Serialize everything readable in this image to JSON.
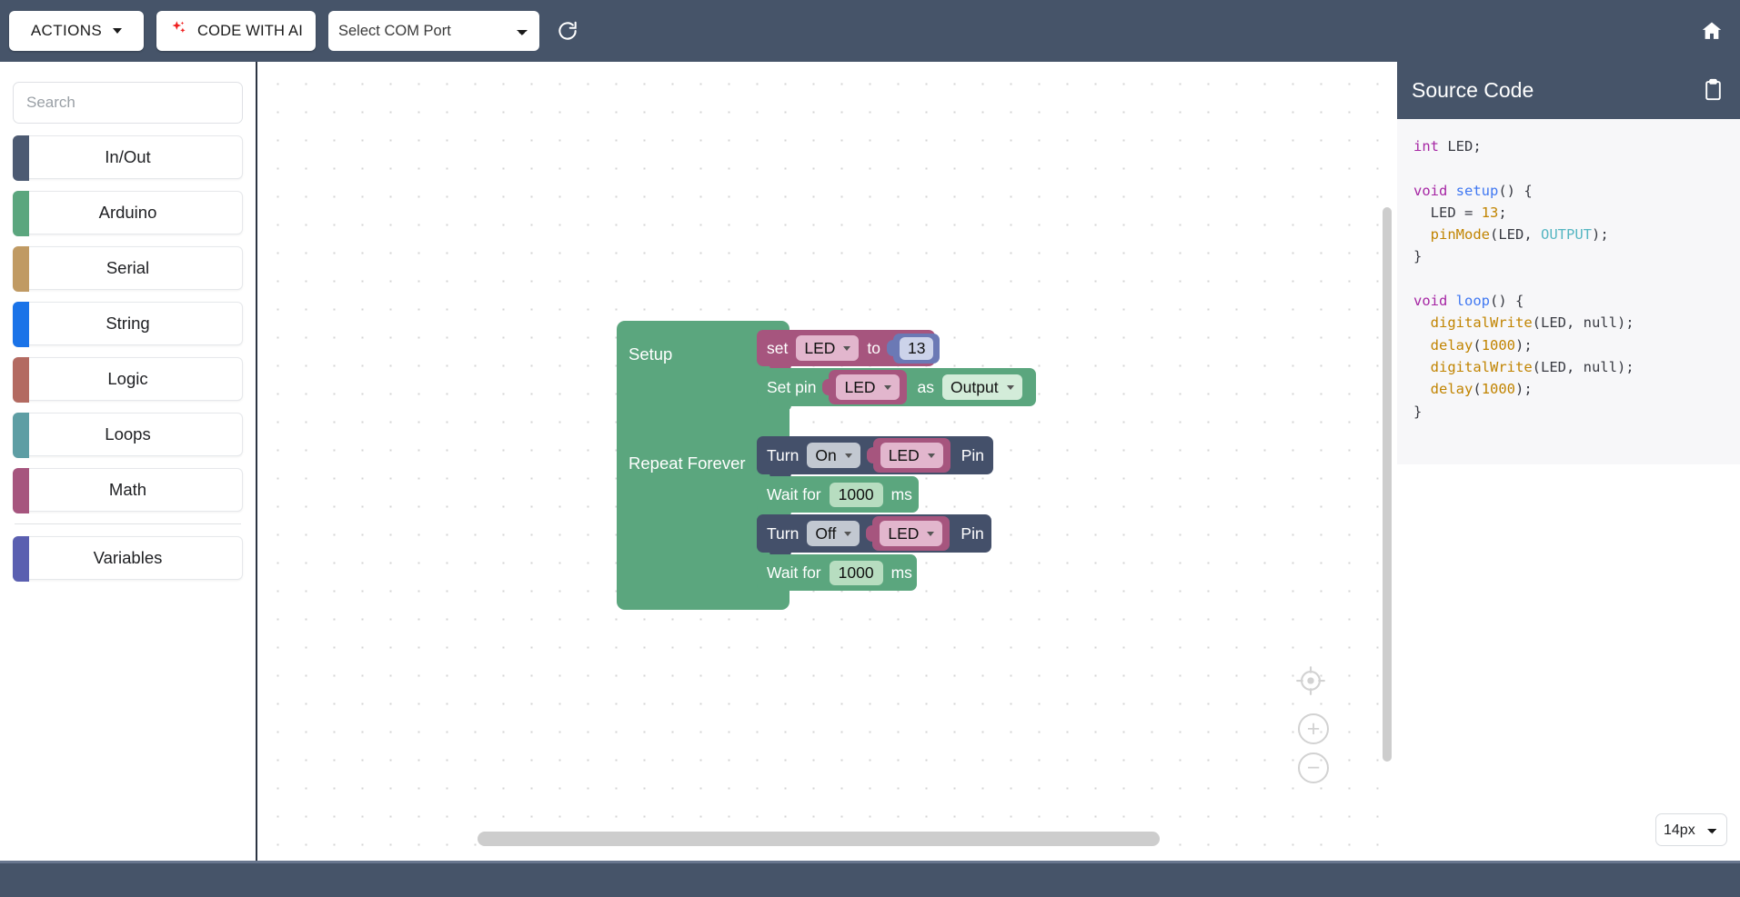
{
  "toolbar": {
    "actions_label": "ACTIONS",
    "code_ai_label": "CODE WITH AI",
    "ai_icon": "sparkle-icon",
    "com_port_value": "Select COM Port",
    "refresh_icon": "refresh-icon",
    "home_icon": "home-icon"
  },
  "sidebar": {
    "search_placeholder": "Search",
    "categories": [
      {
        "label": "In/Out",
        "color": "#4c5a72"
      },
      {
        "label": "Arduino",
        "color": "#5ba67e"
      },
      {
        "label": "Serial",
        "color": "#c09a63"
      },
      {
        "label": "String",
        "color": "#1a73e8"
      },
      {
        "label": "Logic",
        "color": "#b36a61"
      },
      {
        "label": "Loops",
        "color": "#5e9ea4"
      },
      {
        "label": "Math",
        "color": "#a6557e"
      },
      {
        "label": "Variables",
        "color": "#5a5fb0"
      }
    ]
  },
  "canvas": {
    "setup_label": "Setup",
    "repeat_label": "Repeat Forever",
    "blocks": {
      "set_var": {
        "prefix": "set",
        "variable": "LED",
        "middle": "to",
        "value": "13"
      },
      "set_pin": {
        "prefix": "Set pin",
        "variable": "LED",
        "middle": "as",
        "mode": "Output"
      },
      "turn_on": {
        "prefix": "Turn",
        "state": "On",
        "variable": "LED",
        "suffix": "Pin"
      },
      "wait_1": {
        "prefix": "Wait for",
        "value": "1000",
        "suffix": "ms"
      },
      "turn_off": {
        "prefix": "Turn",
        "state": "Off",
        "variable": "LED",
        "suffix": "Pin"
      },
      "wait_2": {
        "prefix": "Wait for",
        "value": "1000",
        "suffix": "ms"
      }
    },
    "controls": {
      "center_icon": "center-target-icon",
      "zoom_in": "+",
      "zoom_out": "−",
      "trash_icon": "trash-icon"
    }
  },
  "code_panel": {
    "title": "Source Code",
    "copy_icon": "clipboard-icon",
    "font_size": "14px",
    "lines": [
      [
        {
          "t": "int",
          "c": "t-kw"
        },
        {
          "t": " LED;",
          "c": "t-plain"
        }
      ],
      [],
      [
        {
          "t": "void",
          "c": "t-kw"
        },
        {
          "t": " ",
          "c": "t-plain"
        },
        {
          "t": "setup",
          "c": "t-fn"
        },
        {
          "t": "() {",
          "c": "t-plain"
        }
      ],
      [
        {
          "t": "  LED = ",
          "c": "t-plain"
        },
        {
          "t": "13",
          "c": "t-num"
        },
        {
          "t": ";",
          "c": "t-plain"
        }
      ],
      [
        {
          "t": "  ",
          "c": "t-plain"
        },
        {
          "t": "pinMode",
          "c": "t-call"
        },
        {
          "t": "(LED, ",
          "c": "t-plain"
        },
        {
          "t": "OUTPUT",
          "c": "t-const"
        },
        {
          "t": ");",
          "c": "t-plain"
        }
      ],
      [
        {
          "t": "}",
          "c": "t-plain"
        }
      ],
      [],
      [
        {
          "t": "void",
          "c": "t-kw"
        },
        {
          "t": " ",
          "c": "t-plain"
        },
        {
          "t": "loop",
          "c": "t-fn"
        },
        {
          "t": "() {",
          "c": "t-plain"
        }
      ],
      [
        {
          "t": "  ",
          "c": "t-plain"
        },
        {
          "t": "digitalWrite",
          "c": "t-call"
        },
        {
          "t": "(LED, null);",
          "c": "t-plain"
        }
      ],
      [
        {
          "t": "  ",
          "c": "t-plain"
        },
        {
          "t": "delay",
          "c": "t-call"
        },
        {
          "t": "(",
          "c": "t-plain"
        },
        {
          "t": "1000",
          "c": "t-num"
        },
        {
          "t": ");",
          "c": "t-plain"
        }
      ],
      [
        {
          "t": "  ",
          "c": "t-plain"
        },
        {
          "t": "digitalWrite",
          "c": "t-call"
        },
        {
          "t": "(LED, null);",
          "c": "t-plain"
        }
      ],
      [
        {
          "t": "  ",
          "c": "t-plain"
        },
        {
          "t": "delay",
          "c": "t-call"
        },
        {
          "t": "(",
          "c": "t-plain"
        },
        {
          "t": "1000",
          "c": "t-num"
        },
        {
          "t": ");",
          "c": "t-plain"
        }
      ],
      [
        {
          "t": "}",
          "c": "t-plain"
        }
      ]
    ]
  },
  "colors": {
    "header_bg": "#465469",
    "green_block": "#5ba67e",
    "pink_block": "#a6557e",
    "dark_block": "#44506a",
    "number_block": "#6b79b5"
  }
}
